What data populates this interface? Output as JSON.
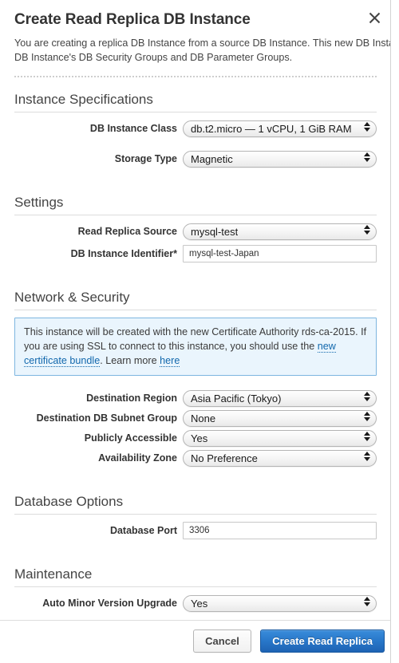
{
  "dialog": {
    "title": "Create Read Replica DB Instance",
    "close_icon": "close-icon",
    "intro_line_1": "You are creating a replica DB Instance from a source DB Instance. This new DB Instance w",
    "intro_line_2": "DB Instance's DB Security Groups and DB Parameter Groups."
  },
  "sections": {
    "instance_specifications": {
      "title": "Instance Specifications",
      "db_instance_class": {
        "label": "DB Instance Class",
        "value": "db.t2.micro — 1 vCPU, 1 GiB RAM"
      },
      "storage_type": {
        "label": "Storage Type",
        "value": "Magnetic"
      }
    },
    "settings": {
      "title": "Settings",
      "read_replica_source": {
        "label": "Read Replica Source",
        "value": "mysql-test"
      },
      "db_instance_identifier": {
        "label": "DB Instance Identifier*",
        "value": "mysql-test-Japan",
        "placeholder": ""
      }
    },
    "network_security": {
      "title": "Network & Security",
      "notice": {
        "text_part_1": "This instance will be created with the new Certificate Authority rds-ca-2015. If you are using SSL to connect to this instance, you should use the ",
        "link_1": "new certificate bundle",
        "text_part_2": ". Learn more ",
        "link_2": "here",
        "background_color": "#eaf5fd",
        "border_color": "#7eb6e0",
        "link_color": "#1268ad"
      },
      "destination_region": {
        "label": "Destination Region",
        "value": "Asia Pacific (Tokyo)"
      },
      "destination_db_subnet_group": {
        "label": "Destination DB Subnet Group",
        "value": "None"
      },
      "publicly_accessible": {
        "label": "Publicly Accessible",
        "value": "Yes"
      },
      "availability_zone": {
        "label": "Availability Zone",
        "value": "No Preference"
      }
    },
    "database_options": {
      "title": "Database Options",
      "database_port": {
        "label": "Database Port",
        "value": "3306",
        "placeholder": ""
      }
    },
    "maintenance": {
      "title": "Maintenance",
      "auto_minor_version_upgrade": {
        "label": "Auto Minor Version Upgrade",
        "value": "Yes"
      }
    }
  },
  "footer": {
    "cancel_label": "Cancel",
    "submit_label": "Create Read Replica",
    "submit_color": "#2877c9"
  }
}
